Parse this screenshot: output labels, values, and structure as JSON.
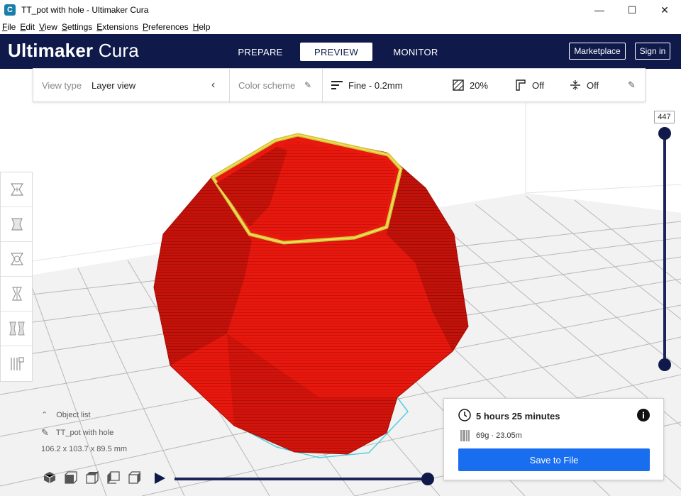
{
  "window": {
    "title": "TT_pot with hole - Ultimaker Cura",
    "app_icon_letter": "C",
    "controls": {
      "minimize": "—",
      "maximize": "☐",
      "close": "✕"
    }
  },
  "menu": [
    "File",
    "Edit",
    "View",
    "Settings",
    "Extensions",
    "Preferences",
    "Help"
  ],
  "header": {
    "brand_bold": "Ultimaker",
    "brand_light": " Cura",
    "stages": [
      {
        "label": "PREPARE",
        "active": false
      },
      {
        "label": "PREVIEW",
        "active": true
      },
      {
        "label": "MONITOR",
        "active": false
      }
    ],
    "marketplace_label": "Marketplace",
    "signin_label": "Sign in",
    "background_color": "#0f1a4a"
  },
  "view_toolbar": {
    "view_type_label": "View type",
    "view_type_value": "Layer view",
    "color_scheme_label": "Color scheme",
    "profile_value": "Fine - 0.2mm",
    "infill_value": "20%",
    "support_value": "Off",
    "adhesion_value": "Off"
  },
  "left_tools": [
    "move-tool-icon",
    "scale-tool-icon",
    "rotate-tool-icon",
    "mirror-tool-icon",
    "per-model-settings-icon",
    "support-blocker-icon"
  ],
  "layer_slider": {
    "current_layer": "447",
    "max_layer": 447
  },
  "object_panel": {
    "object_list_label": "Object list",
    "object_name": "TT_pot with hole",
    "dimensions": "106.2 x 103.7 x 89.5 mm"
  },
  "camera_views": [
    "3d-view-icon",
    "front-view-icon",
    "top-view-icon",
    "left-view-icon",
    "right-view-icon"
  ],
  "print_info": {
    "time": "5 hours 25 minutes",
    "material": "69g · 23.05m",
    "save_label": "Save to File",
    "save_color": "#196ef0"
  },
  "model": {
    "color": "#e8180f",
    "top_ring_color": "#e6d22a"
  }
}
